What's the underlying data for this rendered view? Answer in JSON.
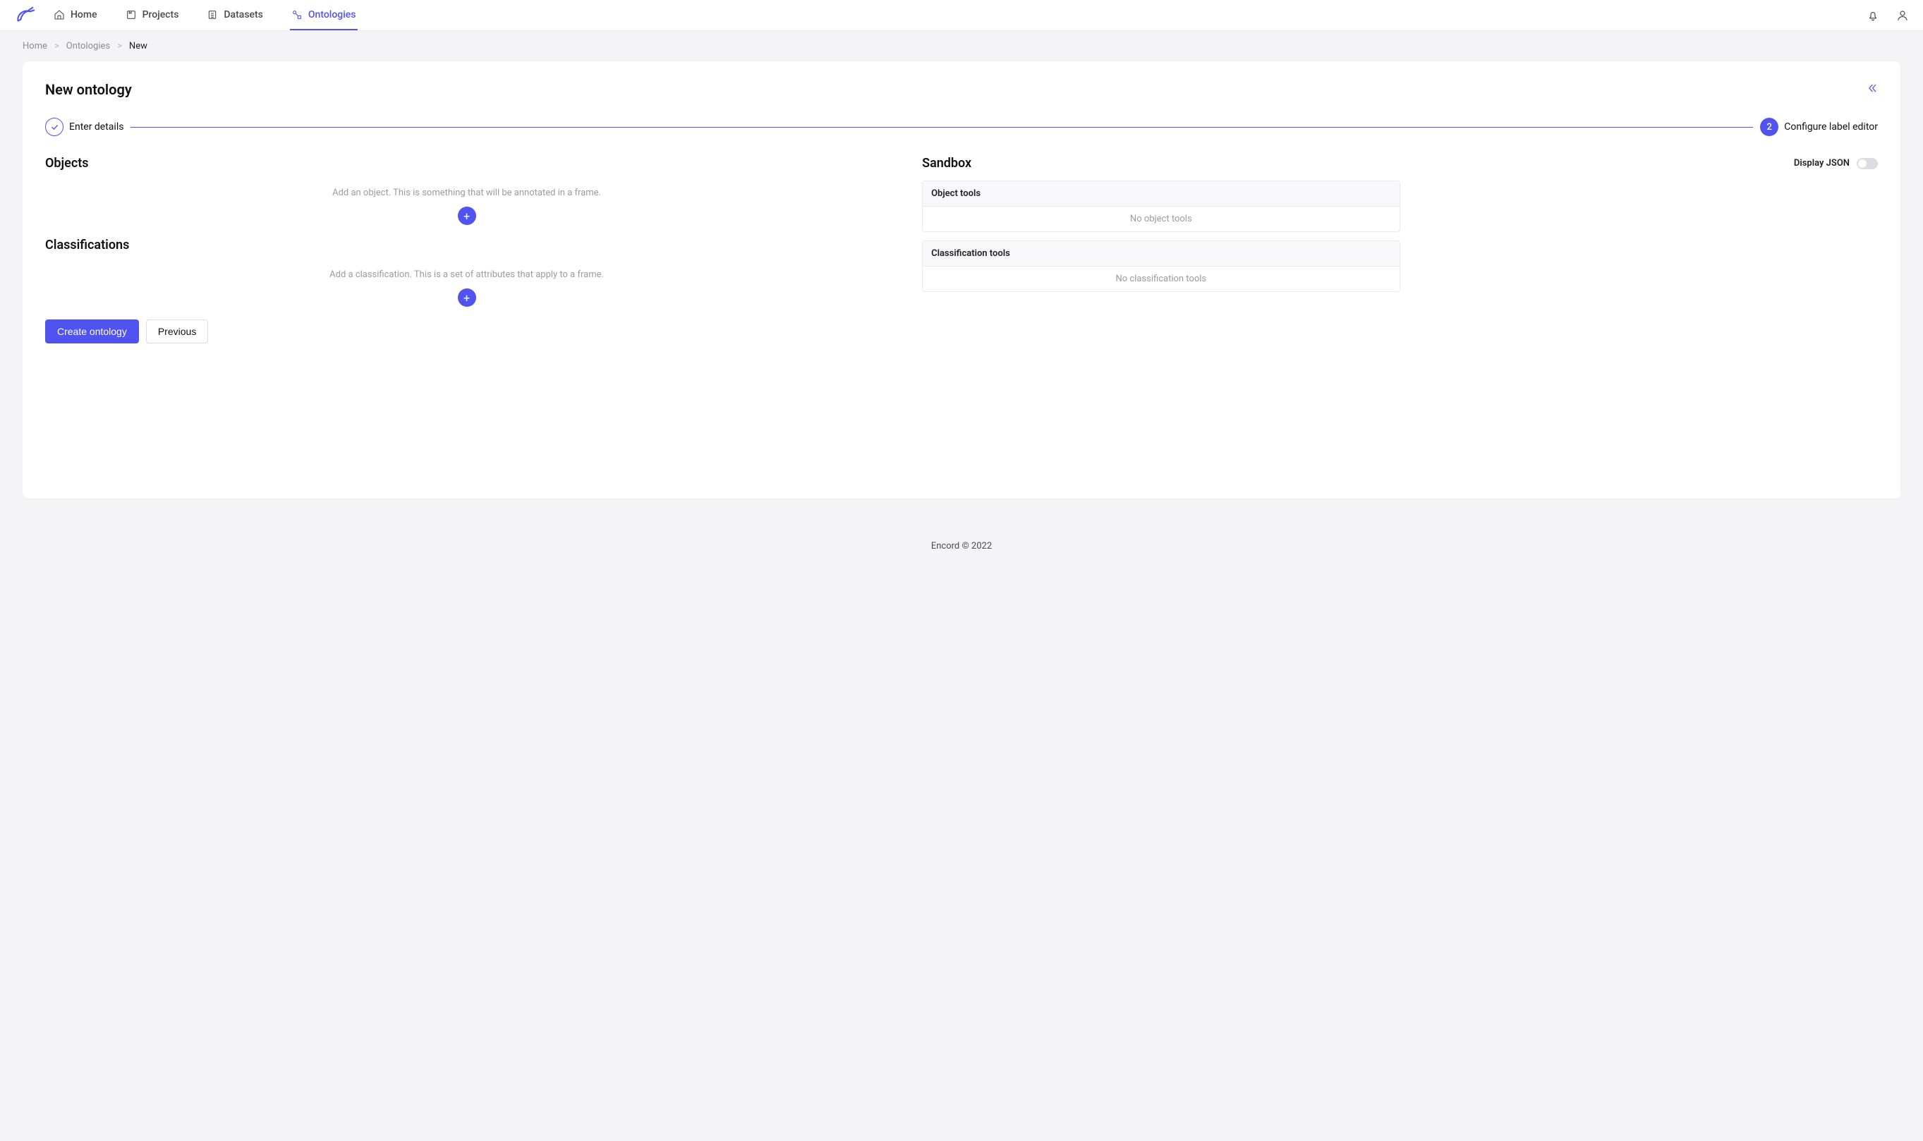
{
  "nav": {
    "home": "Home",
    "projects": "Projects",
    "datasets": "Datasets",
    "ontologies": "Ontologies"
  },
  "breadcrumb": {
    "home": "Home",
    "ontologies": "Ontologies",
    "current": "New"
  },
  "page": {
    "title": "New ontology"
  },
  "stepper": {
    "step1": "Enter details",
    "step2_num": "2",
    "step2": "Configure label editor"
  },
  "objects": {
    "title": "Objects",
    "hint": "Add an object. This is something that will be annotated in a frame."
  },
  "classifications": {
    "title": "Classifications",
    "hint": "Add a classification. This is a set of attributes that apply to a frame."
  },
  "sandbox": {
    "title": "Sandbox",
    "display_json": "Display JSON",
    "object_tools": "Object tools",
    "no_object_tools": "No object tools",
    "classification_tools": "Classification tools",
    "no_classification_tools": "No classification tools"
  },
  "actions": {
    "create": "Create ontology",
    "previous": "Previous"
  },
  "footer": "Encord © 2022"
}
